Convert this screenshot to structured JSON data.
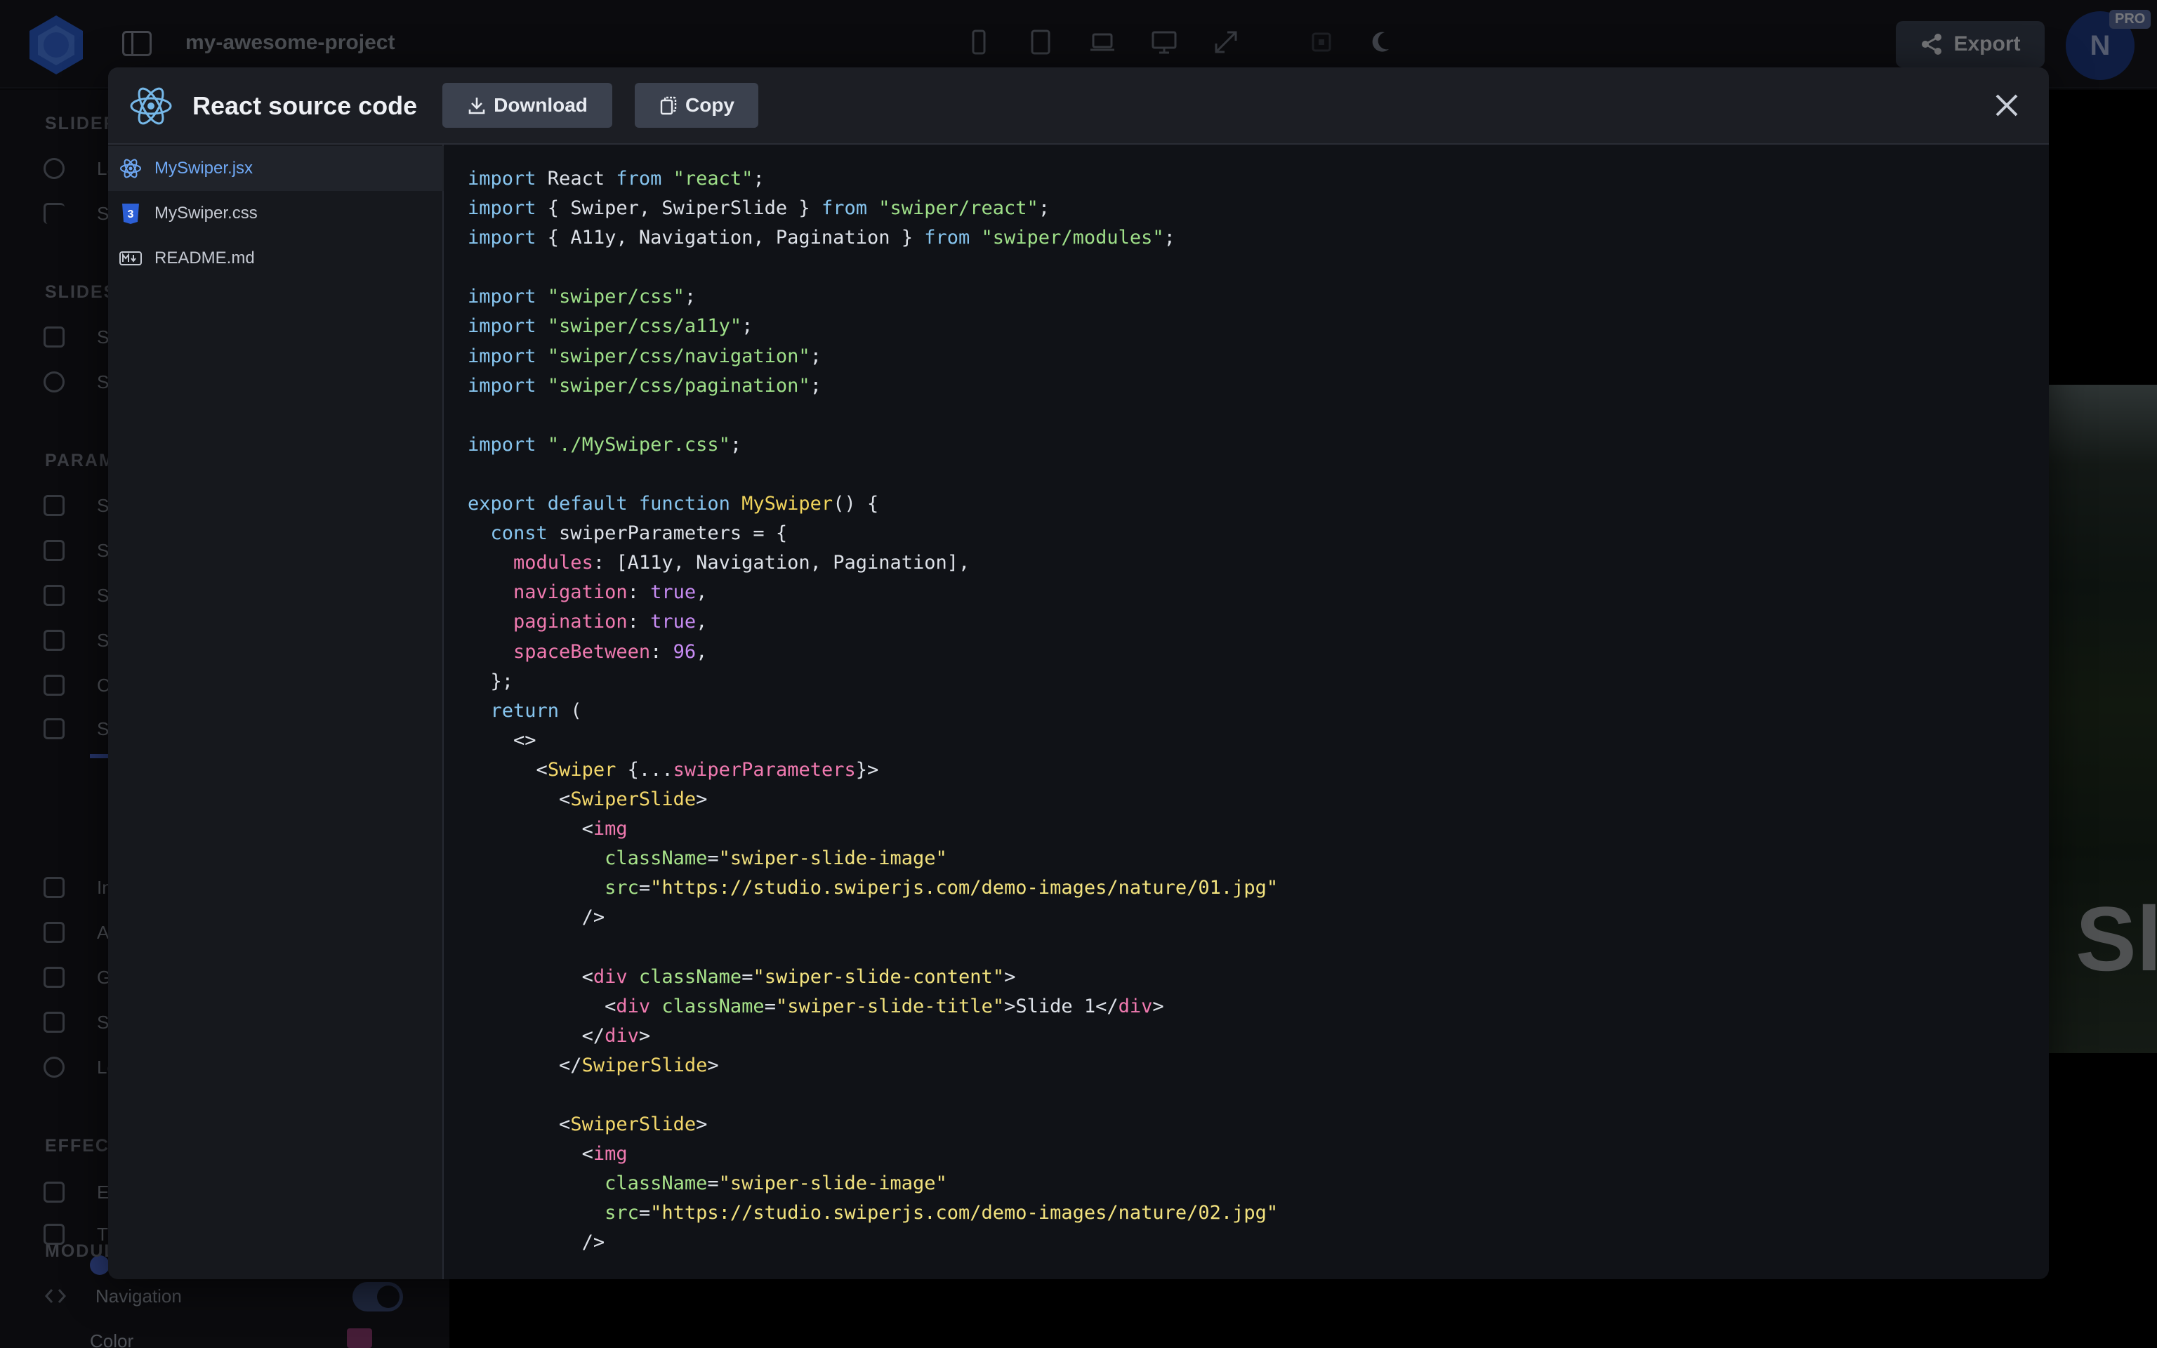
{
  "app": {
    "project_name": "my-awesome-project",
    "export_label": "Export",
    "avatar_initial": "N",
    "pro_badge": "PRO",
    "preview_slide_text": "Sl"
  },
  "settings_panel": {
    "sections": [
      {
        "title": "SLIDER"
      },
      {
        "title": "SLIDES"
      },
      {
        "title": "PARAM"
      },
      {
        "title": "EFFECT"
      },
      {
        "title": "MODUL"
      }
    ],
    "partial_labels": [
      "La",
      "Sli",
      "Sli",
      "Sli",
      "Sli",
      "Sli",
      "Sli",
      "Sli",
      "Ce",
      "Sp",
      "Ini",
      "Au",
      "Gr",
      "Sli",
      "Lo",
      "Ef",
      "Tra"
    ],
    "navigation_label": "Navigation",
    "color_label": "Color"
  },
  "modal": {
    "title": "React source code",
    "download_label": "Download",
    "copy_label": "Copy",
    "files": [
      {
        "name": "MySwiper.jsx",
        "icon": "react-icon",
        "active": true
      },
      {
        "name": "MySwiper.css",
        "icon": "css-icon",
        "active": false
      },
      {
        "name": "README.md",
        "icon": "markdown-icon",
        "active": false
      }
    ]
  },
  "code": {
    "l1_a": "import",
    "l1_b": " React ",
    "l1_c": "from",
    "l1_d": "\"react\"",
    "l1_e": ";",
    "l2_a": "import",
    "l2_b": " { Swiper, SwiperSlide } ",
    "l2_c": "from",
    "l2_d": "\"swiper/react\"",
    "l2_e": ";",
    "l3_a": "import",
    "l3_b": " { A11y, Navigation, Pagination } ",
    "l3_c": "from",
    "l3_d": "\"swiper/modules\"",
    "l3_e": ";",
    "l5_a": "import",
    "l5_d": "\"swiper/css\"",
    "l5_e": ";",
    "l6_a": "import",
    "l6_d": "\"swiper/css/a11y\"",
    "l6_e": ";",
    "l7_a": "import",
    "l7_d": "\"swiper/css/navigation\"",
    "l7_e": ";",
    "l8_a": "import",
    "l8_d": "\"swiper/css/pagination\"",
    "l8_e": ";",
    "l10_a": "import",
    "l10_d": "\"./MySwiper.css\"",
    "l10_e": ";",
    "l12_a": "export default function",
    "l12_b": "MySwiper",
    "l12_c": "() {",
    "l13_a": "const",
    "l13_b": " swiperParameters = {",
    "l14_a": "modules",
    "l14_b": ": [A11y, Navigation, Pagination],",
    "l15_a": "navigation",
    "l15_b": ": ",
    "l15_c": "true",
    "l15_d": ",",
    "l16_a": "pagination",
    "l16_b": ": ",
    "l16_c": "true",
    "l16_d": ",",
    "l17_a": "spaceBetween",
    "l17_b": ": ",
    "l17_c": "96",
    "l17_d": ",",
    "l18": "};",
    "l19_a": "return",
    "l19_b": " (",
    "l20": "<>",
    "l21_a": "<",
    "l21_b": "Swiper",
    "l21_c": " {...",
    "l21_d": "swiperParameters",
    "l21_e": "}>",
    "l22_a": "<",
    "l22_b": "SwiperSlide",
    "l22_c": ">",
    "l23_a": "<",
    "l23_b": "img",
    "l24_a": "className",
    "l24_b": "=",
    "l24_c": "\"swiper-slide-image\"",
    "l25_a": "src",
    "l25_b": "=",
    "l25_c": "\"https://studio.swiperjs.com/demo-images/nature/01.jpg\"",
    "l26": "/>",
    "l28_a": "<",
    "l28_b": "div",
    "l28_c": " ",
    "l28_d": "className",
    "l28_e": "=",
    "l28_f": "\"swiper-slide-content\"",
    "l28_g": ">",
    "l29_a": "<",
    "l29_b": "div",
    "l29_c": " ",
    "l29_d": "className",
    "l29_e": "=",
    "l29_f": "\"swiper-slide-title\"",
    "l29_g": ">Slide 1</",
    "l29_h": "div",
    "l29_i": ">",
    "l30_a": "</",
    "l30_b": "div",
    "l30_c": ">",
    "l31_a": "</",
    "l31_b": "SwiperSlide",
    "l31_c": ">",
    "l33_a": "<",
    "l33_b": "SwiperSlide",
    "l33_c": ">",
    "l34_a": "<",
    "l34_b": "img",
    "l35_a": "className",
    "l35_b": "=",
    "l35_c": "\"swiper-slide-image\"",
    "l36_a": "src",
    "l36_b": "=",
    "l36_c": "\"https://studio.swiperjs.com/demo-images/nature/02.jpg\"",
    "l37": "/>"
  }
}
